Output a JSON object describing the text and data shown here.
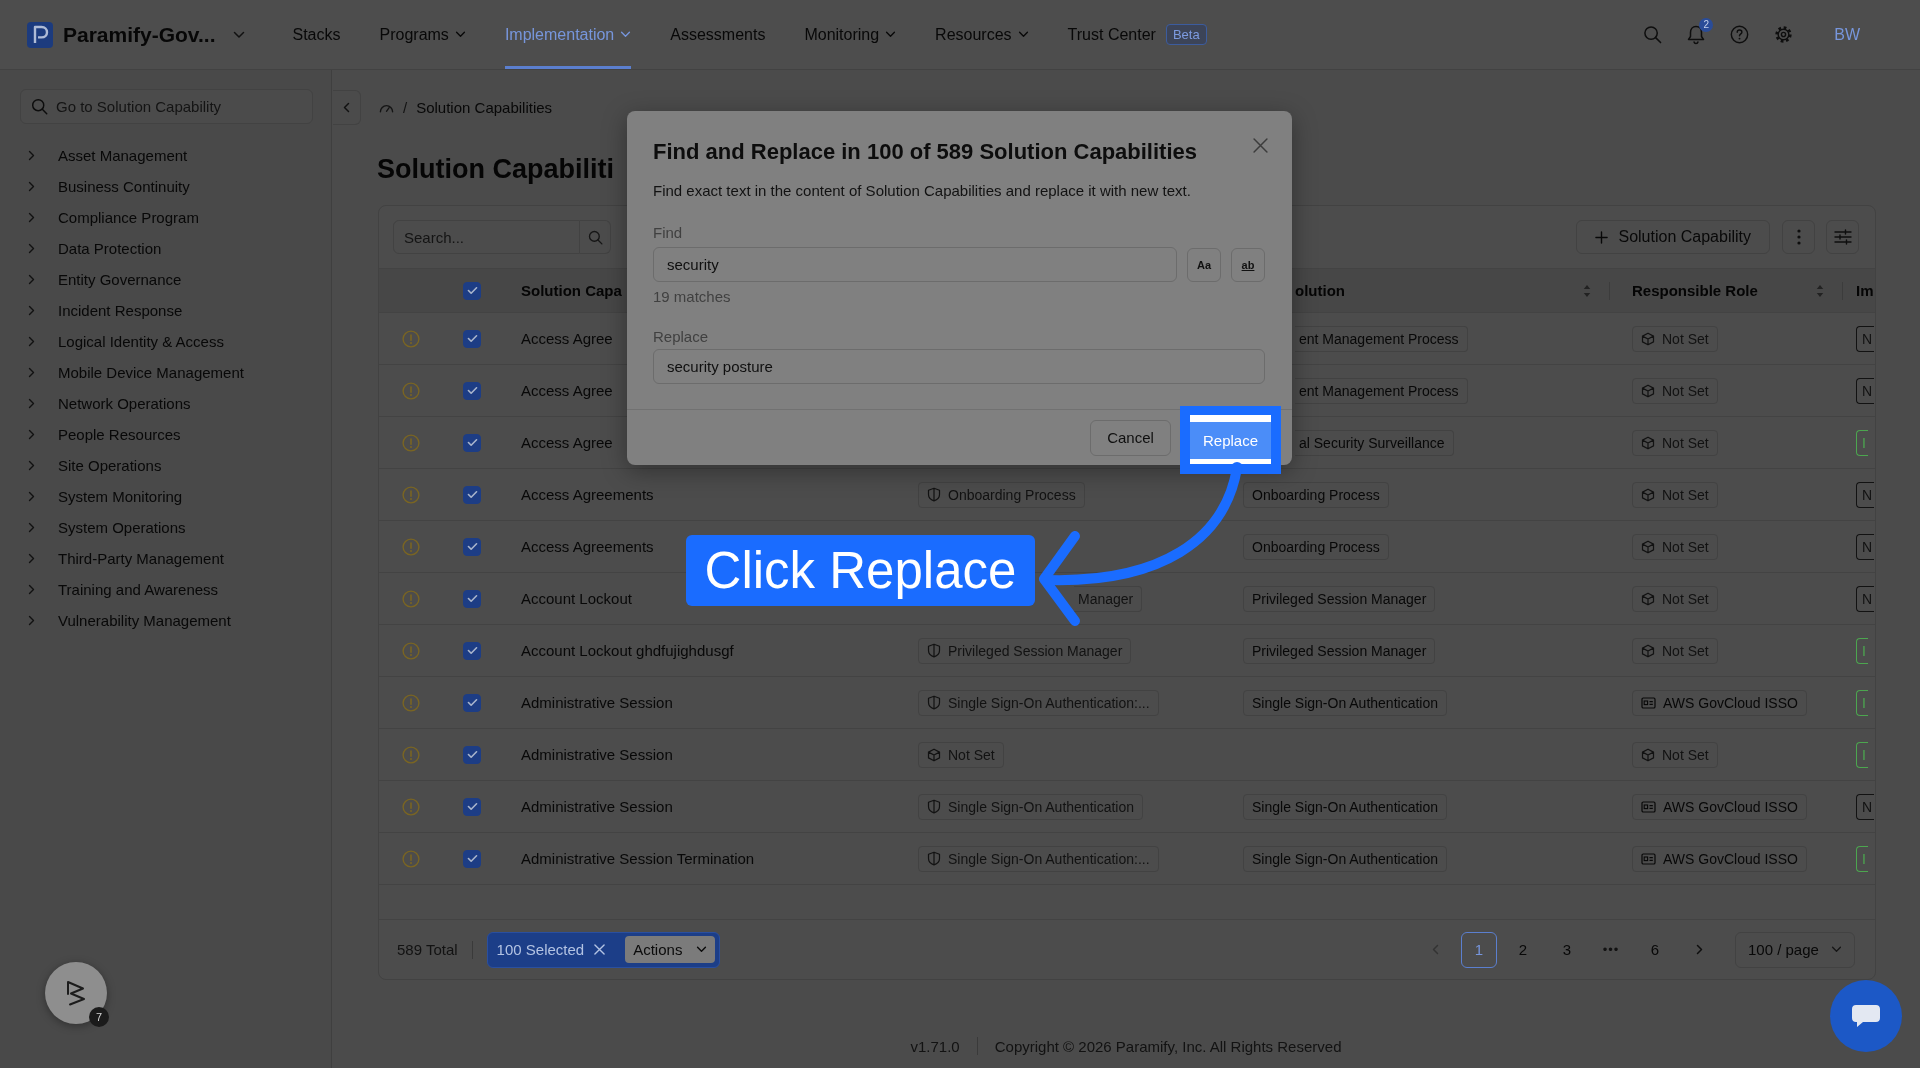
{
  "topbar": {
    "brand": "Paramify-Gov...",
    "nav": [
      {
        "label": "Stacks",
        "dropdown": false,
        "selected": false
      },
      {
        "label": "Programs",
        "dropdown": true,
        "selected": false
      },
      {
        "label": "Implementation",
        "dropdown": true,
        "selected": true
      },
      {
        "label": "Assessments",
        "dropdown": false,
        "selected": false
      },
      {
        "label": "Monitoring",
        "dropdown": true,
        "selected": false
      },
      {
        "label": "Resources",
        "dropdown": true,
        "selected": false
      },
      {
        "label": "Trust Center",
        "dropdown": false,
        "selected": false,
        "badge": "Beta"
      }
    ],
    "notification_count": "2",
    "user_initials": "BW"
  },
  "sidebar": {
    "search": {
      "placeholder": "Go to Solution Capability"
    },
    "items": [
      {
        "label": "Asset Management",
        "expanded": false
      },
      {
        "label": "Business Continuity",
        "expanded": false
      },
      {
        "label": "Compliance Program",
        "expanded": false
      },
      {
        "label": "Data Protection",
        "expanded": false
      },
      {
        "label": "Entity Governance",
        "expanded": false
      },
      {
        "label": "Incident Response",
        "expanded": false
      },
      {
        "label": "Logical Identity & Access",
        "expanded": false
      },
      {
        "label": "Mobile Device Management",
        "expanded": false
      },
      {
        "label": "Network Operations",
        "expanded": false
      },
      {
        "label": "People Resources",
        "expanded": false
      },
      {
        "label": "Site Operations",
        "expanded": false
      },
      {
        "label": "System Monitoring",
        "expanded": false
      },
      {
        "label": "System Operations",
        "expanded": false
      },
      {
        "label": "Third-Party Management",
        "expanded": false
      },
      {
        "label": "Training and Awareness",
        "expanded": false
      },
      {
        "label": "Vulnerability Management",
        "expanded": false
      }
    ]
  },
  "breadcrumb": {
    "separator": "/",
    "current": "Solution Capabilities"
  },
  "page_title": "Solution Capabiliti",
  "table": {
    "search": {
      "placeholder": "Search..."
    },
    "add_button": "Solution Capability",
    "header_checked": true,
    "columns": {
      "name": {
        "label": "Solution Capa"
      },
      "column_4": {
        "label": "olution",
        "sortable": true,
        "clipped": true
      },
      "responsible_role": {
        "label": "Responsible Role",
        "sortable": true
      },
      "column_6": {
        "label": "Im"
      }
    },
    "rows": [
      {
        "warning": true,
        "checked": true,
        "name": "Access Agree",
        "column_4": {
          "text": "ent Management Process",
          "kind": "clipped"
        },
        "responsible_role": {
          "text": "Not Set",
          "kind": "unset"
        },
        "column_6": {
          "text": "N",
          "color": "#121212"
        }
      },
      {
        "warning": true,
        "checked": true,
        "name": "Access Agree",
        "column_4": {
          "text": "ent Management Process",
          "kind": "clipped"
        },
        "responsible_role": {
          "text": "Not Set",
          "kind": "unset"
        },
        "column_6": {
          "text": "N",
          "color": "#121212"
        }
      },
      {
        "warning": true,
        "checked": true,
        "name": "Access Agree",
        "column_4": {
          "text": "al Security Surveillance",
          "kind": "clipped"
        },
        "responsible_role": {
          "text": "Not Set",
          "kind": "unset"
        },
        "column_6": {
          "text": "I",
          "color": "#4ca64f"
        }
      },
      {
        "warning": true,
        "checked": true,
        "name": "Access Agreements",
        "column_3": {
          "text": "Onboarding Process",
          "kind": "linked"
        },
        "column_4": {
          "text": "Onboarding Process",
          "kind": "plain"
        },
        "responsible_role": {
          "text": "Not Set",
          "kind": "unset"
        },
        "column_6": {
          "text": "N",
          "color": "#121212"
        }
      },
      {
        "warning": true,
        "checked": true,
        "name": "Access Agreements",
        "column_4": {
          "text": "Onboarding Process",
          "kind": "plain"
        },
        "responsible_role": {
          "text": "Not Set",
          "kind": "unset"
        },
        "column_6": {
          "text": "N",
          "color": "#121212"
        }
      },
      {
        "warning": true,
        "checked": true,
        "name": "Account Lockout",
        "column_3": {
          "text": "Manager",
          "kind": "clipped"
        },
        "column_4": {
          "text": "Privileged Session Manager",
          "kind": "plain"
        },
        "responsible_role": {
          "text": "Not Set",
          "kind": "unset"
        },
        "column_6": {
          "text": "N",
          "color": "#121212"
        }
      },
      {
        "warning": true,
        "checked": true,
        "name": "Account Lockout ghdfujighdusgf",
        "column_3": {
          "text": "Privileged Session Manager",
          "kind": "linked"
        },
        "column_4": {
          "text": "Privileged Session Manager",
          "kind": "plain"
        },
        "responsible_role": {
          "text": "Not Set",
          "kind": "unset"
        },
        "column_6": {
          "text": "I",
          "color": "#4ca64f"
        }
      },
      {
        "warning": true,
        "checked": true,
        "name": "Administrative Session",
        "column_3": {
          "text": "Single Sign-On Authentication:...",
          "kind": "linked"
        },
        "column_4": {
          "text": "Single Sign-On Authentication",
          "kind": "plain"
        },
        "responsible_role": {
          "text": "AWS GovCloud ISSO",
          "kind": "assigned"
        },
        "column_6": {
          "text": "I",
          "color": "#4ca64f"
        }
      },
      {
        "warning": true,
        "checked": true,
        "name": "Administrative Session",
        "column_3": {
          "text": "Not Set",
          "kind": "unset"
        },
        "responsible_role": {
          "text": "Not Set",
          "kind": "unset"
        },
        "column_6": {
          "text": "I",
          "color": "#4ca64f"
        }
      },
      {
        "warning": true,
        "checked": true,
        "name": "Administrative Session",
        "column_3": {
          "text": "Single Sign-On Authentication",
          "kind": "linked"
        },
        "column_4": {
          "text": "Single Sign-On Authentication",
          "kind": "plain"
        },
        "responsible_role": {
          "text": "AWS GovCloud ISSO",
          "kind": "assigned"
        },
        "column_6": {
          "text": "N",
          "color": "#121212"
        }
      },
      {
        "warning": true,
        "checked": true,
        "name": "Administrative Session Termination",
        "column_3": {
          "text": "Single Sign-On Authentication:...",
          "kind": "linked"
        },
        "column_4": {
          "text": "Single Sign-On Authentication",
          "kind": "plain"
        },
        "responsible_role": {
          "text": "AWS GovCloud ISSO",
          "kind": "assigned"
        },
        "column_6": {
          "text": "I",
          "color": "#4ca64f"
        }
      }
    ],
    "footer": {
      "total": "589 Total",
      "selection": {
        "label": "100 Selected",
        "actions": "Actions"
      },
      "pagination": {
        "prev_disabled": true,
        "next_disabled": false,
        "pages": [
          {
            "label": "1",
            "kind": "page",
            "selected": true
          },
          {
            "label": "2",
            "kind": "page",
            "selected": false
          },
          {
            "label": "3",
            "kind": "page",
            "selected": false
          },
          {
            "label": "•••",
            "kind": "ellipsis",
            "selected": false
          },
          {
            "label": "6",
            "kind": "page",
            "selected": false
          }
        ],
        "page_size": "100 / page"
      }
    }
  },
  "footer": {
    "version": "v1.71.0",
    "copyright": "Copyright © 2026 Paramify, Inc. All Rights Reserved"
  },
  "help_launcher": {
    "badge": "7"
  },
  "modal": {
    "title": "Find and Replace in 100 of 589 Solution Capabilities",
    "description": "Find exact text in the content of Solution Capabilities and replace it with new text.",
    "find": {
      "label": "Find",
      "value": "security",
      "matches": "19 matches"
    },
    "options": [
      {
        "label": "Aa",
        "kind": "case",
        "selected": false
      },
      {
        "label": "ab",
        "kind": "word",
        "selected": false
      }
    ],
    "replace": {
      "label": "Replace",
      "value": "security posture"
    },
    "buttons": [
      {
        "label": "Cancel",
        "kind": "secondary",
        "highlighted": false
      },
      {
        "label": "Replace",
        "kind": "primary",
        "highlighted": true
      }
    ]
  },
  "annotation": {
    "label": "Click Replace"
  }
}
